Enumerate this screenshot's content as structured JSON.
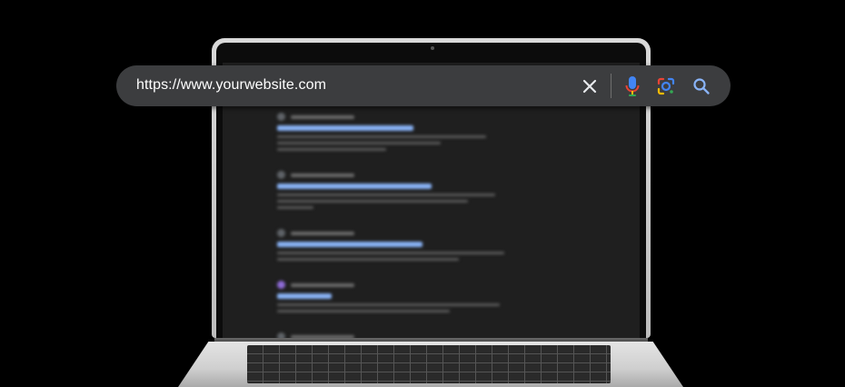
{
  "search_bar": {
    "url": "https://www.yourwebsite.com",
    "icons": {
      "clear": "close-icon",
      "voice": "mic-icon",
      "lens": "camera-lens-icon",
      "search": "search-icon"
    }
  },
  "colors": {
    "search_bar_bg": "#3c3d3f",
    "url_text": "#ffffff",
    "screen_bg": "#1f1f1f",
    "result_title": "#8ab4f8"
  }
}
